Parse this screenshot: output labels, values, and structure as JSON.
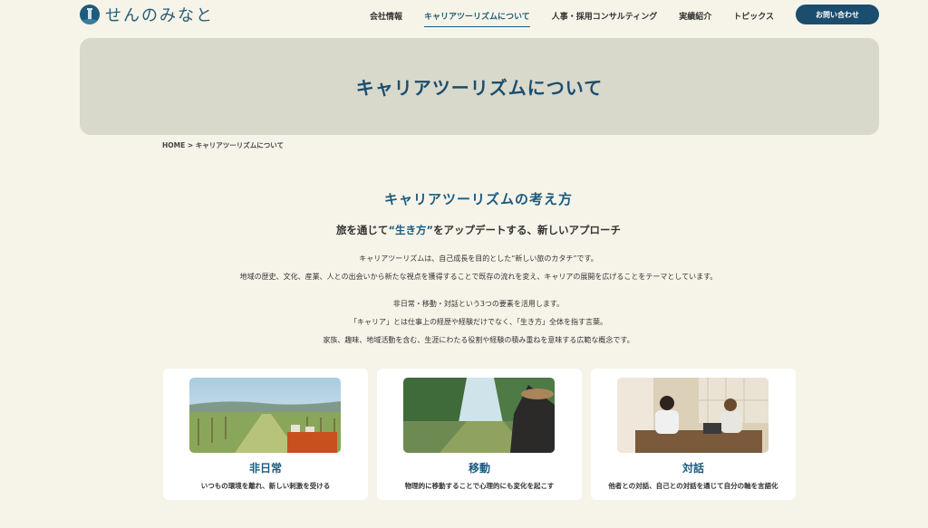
{
  "header": {
    "logo_text": "せんのみなと",
    "nav": [
      "会社情報",
      "キャリアツーリズムについて",
      "人事・採用コンサルティング",
      "実績紹介",
      "トピックス"
    ],
    "contact_label": "お問い合わせ"
  },
  "hero": {
    "title": "キャリアツーリズムについて"
  },
  "breadcrumb": {
    "home": "HOME",
    "sep": ">",
    "current": "キャリアツーリズムについて"
  },
  "section": {
    "title": "キャリアツーリズムの考え方",
    "subtitle_pre": "旅を通じて",
    "subtitle_hl": "“生き方”",
    "subtitle_post": "をアップデートする、新しいアプローチ",
    "p1": [
      "キャリアツーリズムは、自己成長を目的とした“新しい旅のカタチ”です。",
      "地域の歴史、文化、産業、人との出会いから新たな視点を獲得することで既存の流れを変え、キャリアの展開を広げることをテーマとしています。"
    ],
    "p2": [
      "非日常・移動・対話という3つの要素を活用します。",
      "「キャリア」とは仕事上の経歴や経験だけでなく、「生き方」全体を指す言葉。",
      "家族、趣味、地域活動を含む、生涯にわたる役割や経験の積み重ねを意味する広範な概念です。"
    ]
  },
  "cards": [
    {
      "title": "非日常",
      "desc": "いつもの環境を離れ、新しい刺激を受ける"
    },
    {
      "title": "移動",
      "desc": "物理的に移動することで心理的にも変化を起こす"
    },
    {
      "title": "対話",
      "desc": "他者との対話、自己との対話を通じて自分の軸を言語化"
    }
  ]
}
